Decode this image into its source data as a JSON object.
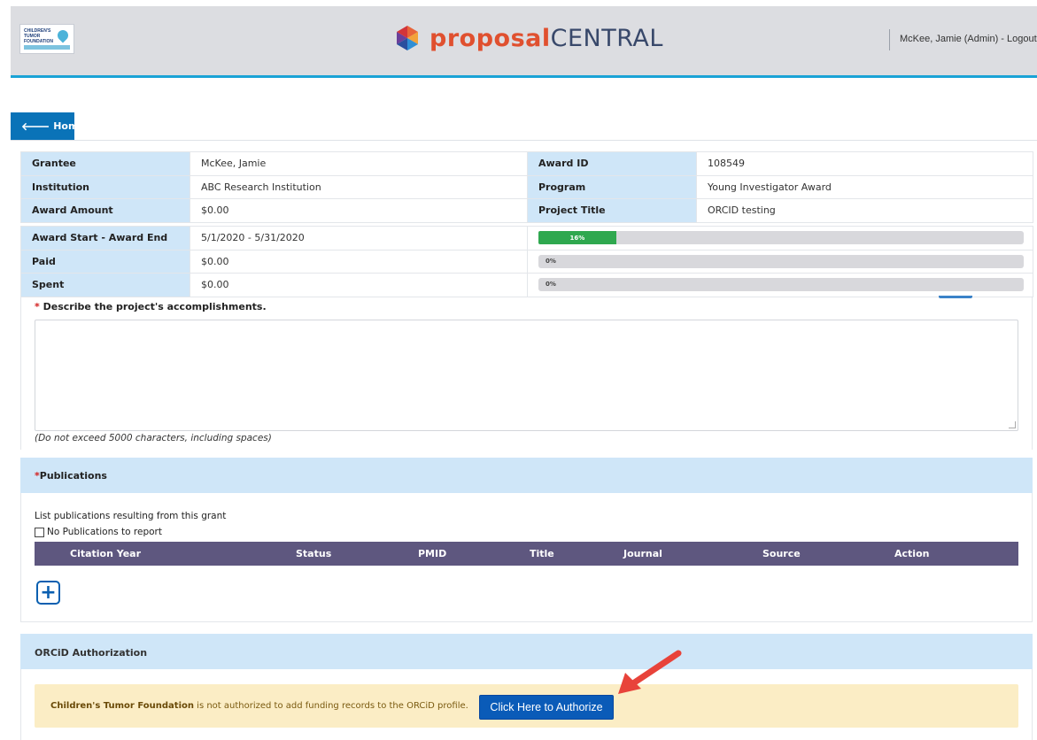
{
  "header": {
    "brand_prefix": "proposal",
    "brand_suffix": "CENTRAL",
    "user_text": "McKee, Jamie (Admin) - Logout",
    "logo_text": "CHILDREN'S TUMOR FOUNDATION",
    "brand_color": "#e0502f",
    "accent_color": "#1aa3d6"
  },
  "nav": {
    "home_label": "Home",
    "home_icon": "arrow-left-icon"
  },
  "award_info": {
    "rows": [
      {
        "label1": "Grantee",
        "value1": "McKee, Jamie",
        "label2": "Award ID",
        "value2": "108549"
      },
      {
        "label1": "Institution",
        "value1": "ABC Research Institution",
        "label2": "Program",
        "value2": "Young Investigator Award"
      },
      {
        "label1": "Award Amount",
        "value1": "$0.00",
        "label2": "Project Title",
        "value2": "ORCID testing"
      }
    ]
  },
  "progress": {
    "rows": [
      {
        "label": "Award Start - Award End",
        "value": "5/1/2020 - 5/31/2020",
        "percent_label": "16%",
        "fraction": 0.16
      },
      {
        "label": "Paid",
        "value": "$0.00",
        "percent_label": "0%",
        "fraction": 0
      },
      {
        "label": "Spent",
        "value": "$0.00",
        "percent_label": "0%",
        "fraction": 0
      }
    ],
    "fill_color": "#2fa84f"
  },
  "accomplishments": {
    "required_mark": "*",
    "label": "Describe the project's accomplishments.",
    "value": "",
    "note": "(Do not exceed 5000 characters, including spaces)"
  },
  "publications": {
    "required_mark": "*",
    "title": "Publications",
    "description": "List publications resulting from this grant",
    "no_pub_label": "No Publications to report",
    "no_pub_checked": false,
    "columns": [
      "Citation Year",
      "Status",
      "PMID",
      "Title",
      "Journal",
      "Source",
      "Action"
    ],
    "add_icon": "plus-icon",
    "header_color": "#5e577f"
  },
  "orcid": {
    "title": "ORCiD Authorization",
    "org_name": "Children's Tumor Foundation",
    "message": " is not authorized to add funding records to the ORCiD profile.",
    "button_label": "Click Here to Authorize",
    "warning_bg": "#fbedc5"
  }
}
